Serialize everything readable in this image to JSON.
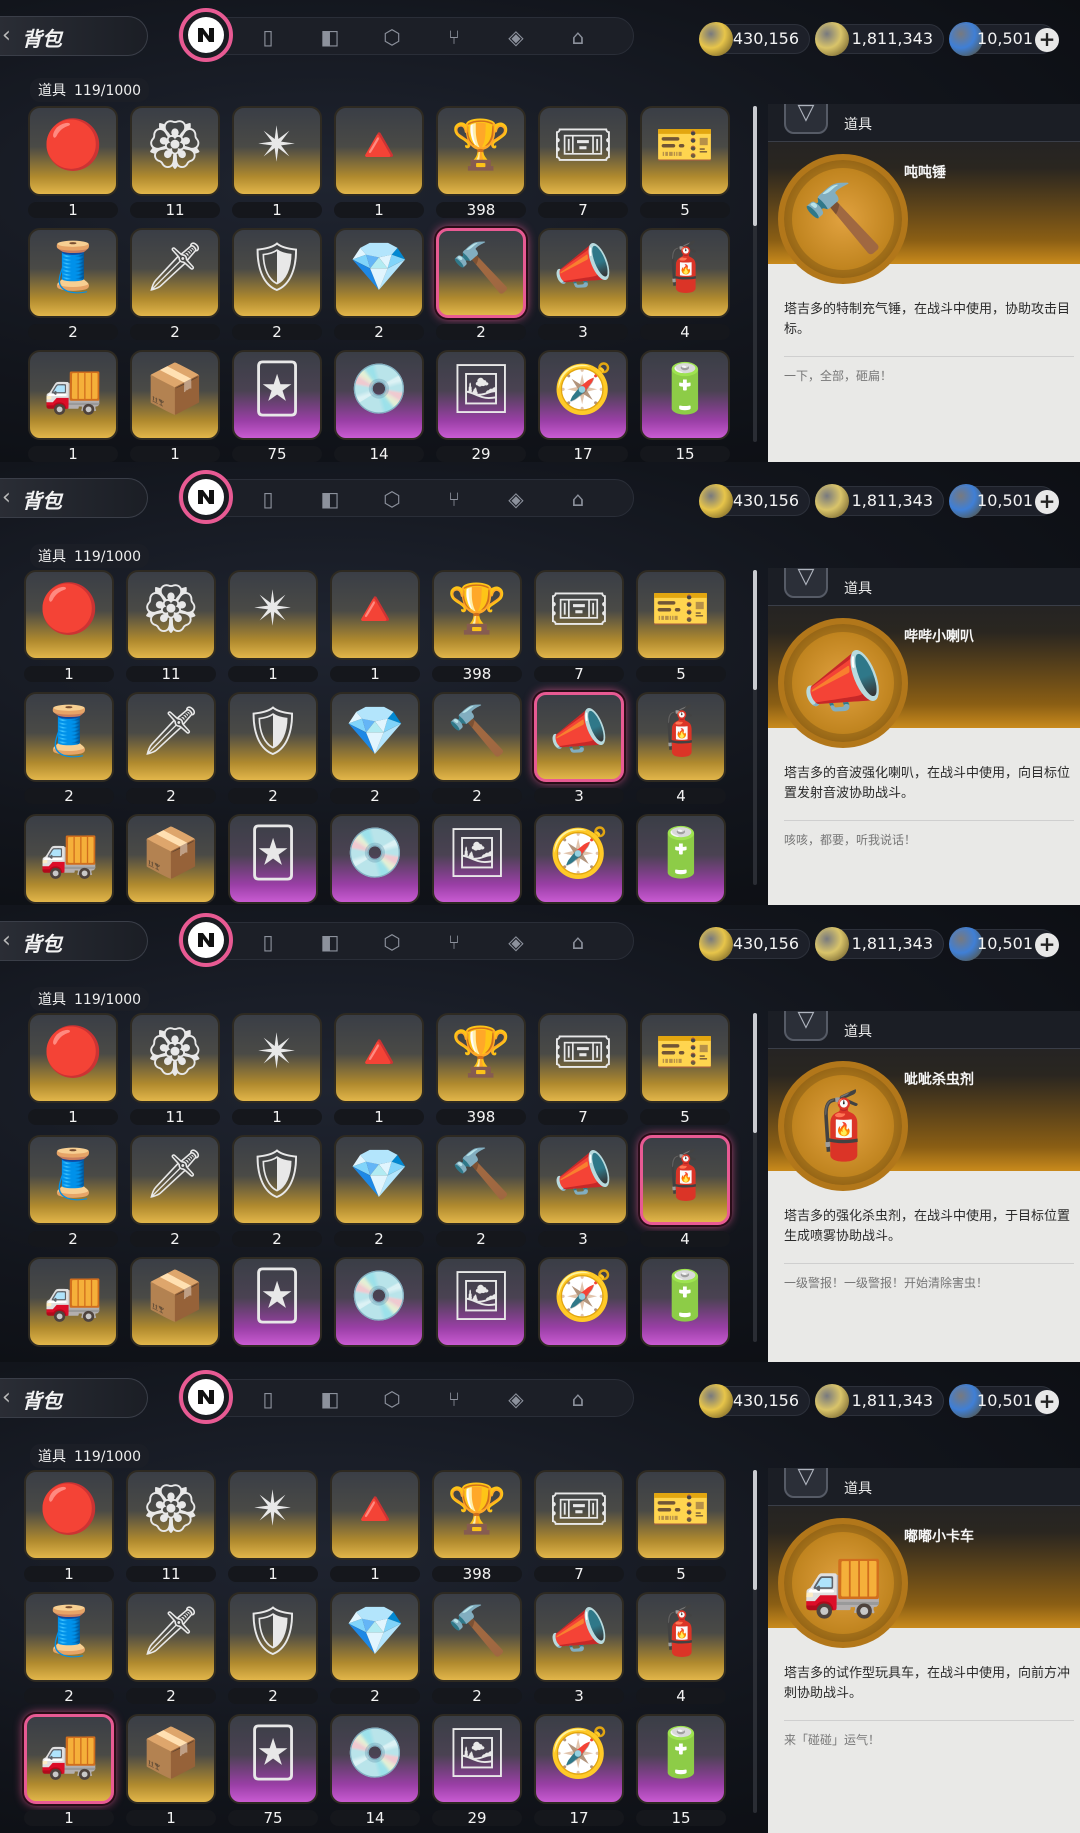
{
  "header": {
    "title": "背包",
    "back_glyph": "‹",
    "tabs": [
      {
        "name": "all",
        "icon": "n-logo-icon"
      },
      {
        "name": "gameboy",
        "icon": "gameboy-icon"
      },
      {
        "name": "album",
        "icon": "album-icon"
      },
      {
        "name": "box",
        "icon": "box-icon"
      },
      {
        "name": "food",
        "icon": "fork-spoon-icon"
      },
      {
        "name": "cube",
        "icon": "cube-icon"
      },
      {
        "name": "home",
        "icon": "home-icon"
      }
    ],
    "currencies": [
      {
        "name": "coin",
        "value": "430,156",
        "color": "#e7c54a"
      },
      {
        "name": "ticket",
        "value": "1,811,343",
        "color": "#d9c46a"
      },
      {
        "name": "crystal",
        "value": "10,501",
        "color": "#3f7fd6"
      }
    ],
    "plus_glyph": "+"
  },
  "inventory": {
    "label": "道具",
    "count": "119/1000",
    "rarity_colors": {
      "gold": "#e2b64a",
      "purple": "#c95bd2"
    },
    "items": [
      {
        "id": "fire-orb",
        "glyph": "🔴",
        "qty": "1",
        "rarity": "gold"
      },
      {
        "id": "wax-seal",
        "glyph": "🏵",
        "qty": "11",
        "rarity": "gold"
      },
      {
        "id": "dark-star",
        "glyph": "✴",
        "qty": "1",
        "rarity": "gold"
      },
      {
        "id": "red-cloak",
        "glyph": "🔺",
        "qty": "1",
        "rarity": "gold"
      },
      {
        "id": "gold-trophy",
        "glyph": "🏆",
        "qty": "398",
        "rarity": "gold"
      },
      {
        "id": "ticket-pink",
        "glyph": "🎟",
        "qty": "7",
        "rarity": "gold"
      },
      {
        "id": "ticket-blue",
        "glyph": "🎫",
        "qty": "5",
        "rarity": "gold"
      },
      {
        "id": "thread-spool",
        "glyph": "🧵",
        "qty": "2",
        "rarity": "gold"
      },
      {
        "id": "magic-sword",
        "glyph": "🗡",
        "qty": "2",
        "rarity": "gold"
      },
      {
        "id": "armor",
        "glyph": "🛡",
        "qty": "2",
        "rarity": "gold"
      },
      {
        "id": "crystal-shard",
        "glyph": "💎",
        "qty": "2",
        "rarity": "gold"
      },
      {
        "id": "toy-hammer",
        "glyph": "🔨",
        "qty": "2",
        "rarity": "gold"
      },
      {
        "id": "loud-speaker",
        "glyph": "📣",
        "qty": "3",
        "rarity": "gold"
      },
      {
        "id": "spray-can",
        "glyph": "🧯",
        "qty": "4",
        "rarity": "gold"
      },
      {
        "id": "toy-truck",
        "glyph": "🚚",
        "qty": "1",
        "rarity": "gold"
      },
      {
        "id": "supply-box",
        "glyph": "📦",
        "qty": "1",
        "rarity": "gold"
      },
      {
        "id": "card-deck",
        "glyph": "🃏",
        "qty": "75",
        "rarity": "purple"
      },
      {
        "id": "record-player",
        "glyph": "💿",
        "qty": "14",
        "rarity": "purple"
      },
      {
        "id": "photo-frame",
        "glyph": "🖼",
        "qty": "29",
        "rarity": "purple"
      },
      {
        "id": "compass-star",
        "glyph": "🧭",
        "qty": "17",
        "rarity": "purple"
      },
      {
        "id": "dark-capsule",
        "glyph": "🔋",
        "qty": "15",
        "rarity": "purple"
      }
    ]
  },
  "detail_label": "道具",
  "detail_badge_glyph": "▽",
  "panels": [
    {
      "selected": 11,
      "item_glyph": "🔨",
      "item_name": "吨吨锤",
      "description": "塔吉多的特制充气锤，在战斗中使用，协助攻击目标。",
      "flavor": "一下，全部，砸扁！"
    },
    {
      "selected": 12,
      "item_glyph": "📣",
      "item_name": "哔哔小喇叭",
      "description": "塔吉多的音波强化喇叭，在战斗中使用，向目标位置发射音波协助战斗。",
      "flavor": "咳咳，都要，听我说话！"
    },
    {
      "selected": 13,
      "item_glyph": "🧯",
      "item_name": "呲呲杀虫剂",
      "description": "塔吉多的强化杀虫剂，在战斗中使用，于目标位置生成喷雾协助战斗。",
      "flavor": "一级警报！一级警报！开始清除害虫！"
    },
    {
      "selected": 14,
      "item_glyph": "🚚",
      "item_name": "嘟嘟小卡车",
      "description": "塔吉多的试作型玩具车，在战斗中使用，向前方冲刺协助战斗。",
      "flavor": "来「碰碰」运气！"
    }
  ]
}
